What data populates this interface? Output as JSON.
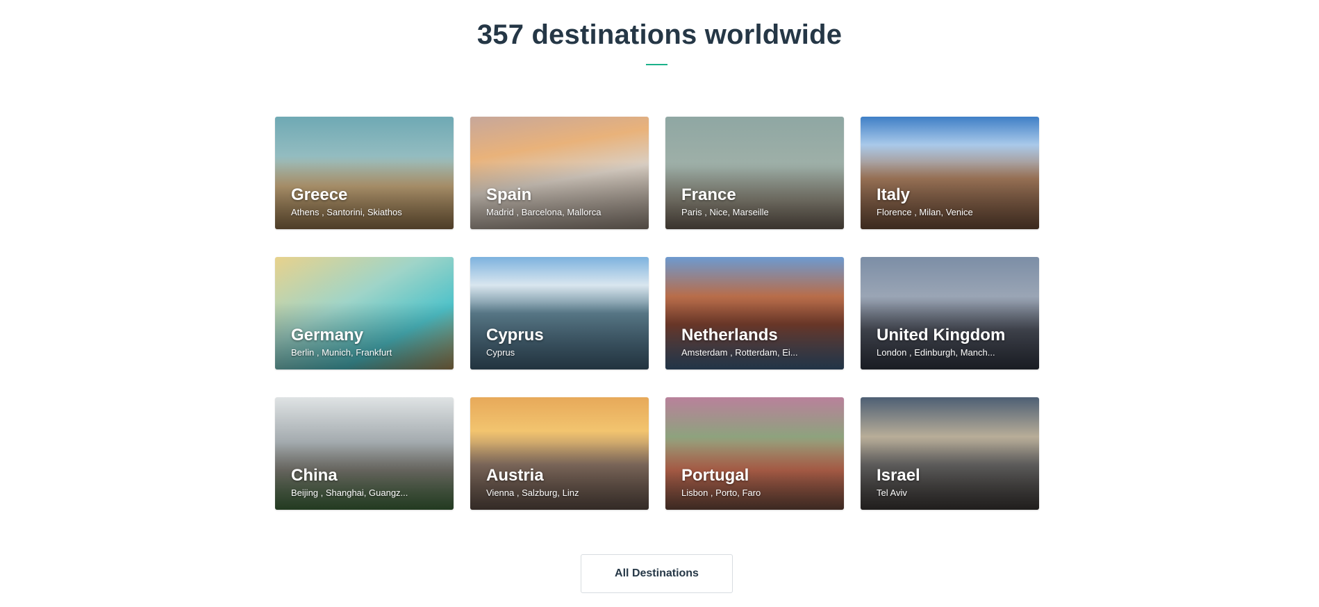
{
  "header": {
    "title": "357 destinations worldwide"
  },
  "accent_color": "#1bb18a",
  "destinations": [
    {
      "name": "Greece",
      "cities": "Athens , Santorini, Skiathos",
      "bg": "linear-gradient(180deg,#6fa9b4 0%,#93bcc0 35%,#c4a77a 62%,#8d6f48 100%)"
    },
    {
      "name": "Spain",
      "cities": "Madrid , Barcelona, Mallorca",
      "bg": "linear-gradient(170deg,#c7a79a 0%,#e9b27a 30%,#d9cfc4 55%,#8e8277 100%)"
    },
    {
      "name": "France",
      "cities": "Paris , Nice, Marseille",
      "bg": "linear-gradient(180deg,#8fa7a3 0%,#9fb0a8 45%,#8e8a7c 75%,#6b5f54 100%)"
    },
    {
      "name": "Italy",
      "cities": "Florence , Milan, Venice",
      "bg": "linear-gradient(180deg,#3f7fc6 0%,#a9c9ea 25%,#a87d5e 55%,#6c4c38 100%)"
    },
    {
      "name": "Germany",
      "cities": "Berlin , Munich, Frankfurt",
      "bg": "linear-gradient(150deg,#e8d28c 0%,#9fd4c8 40%,#4fc2c9 70%,#a88a54 100%)"
    },
    {
      "name": "Cyprus",
      "cities": "Cyprus",
      "bg": "linear-gradient(180deg,#7db2de 0%,#d9e6ef 25%,#5d7f8f 50%,#3e5d72 100%)"
    },
    {
      "name": "Netherlands",
      "cities": "Amsterdam , Rotterdam, Ei...",
      "bg": "linear-gradient(180deg,#6d9ad0 0%,#b86d4a 35%,#7a3f2e 60%,#3e5f80 100%)"
    },
    {
      "name": "United Kingdom",
      "cities": "London , Edinburgh, Manch...",
      "bg": "linear-gradient(180deg,#7c8ea6 0%,#9aa5b5 35%,#4b4f5a 65%,#2f3440 100%)"
    },
    {
      "name": "China",
      "cities": "Beijing , Shanghai, Guangz...",
      "bg": "linear-gradient(180deg,#dfe3e4 0%,#a3aaae 40%,#7c7a72 65%,#3f6a3c 100%)"
    },
    {
      "name": "Austria",
      "cities": "Vienna , Salzburg, Linz",
      "bg": "linear-gradient(180deg,#e7a95a 0%,#f2c46f 30%,#8e7667 60%,#5d4d45 100%)"
    },
    {
      "name": "Portugal",
      "cities": "Lisbon , Porto, Faro",
      "bg": "linear-gradient(180deg,#b9819b 0%,#8ea27e 35%,#c86d53 65%,#6d4a3d 100%)"
    },
    {
      "name": "Israel",
      "cities": "Tel Aviv",
      "bg": "linear-gradient(180deg,#4d5f74 0%,#b8ad98 35%,#6c6b6a 60%,#3a3634 100%)"
    }
  ],
  "footer": {
    "button_label": "All Destinations"
  }
}
